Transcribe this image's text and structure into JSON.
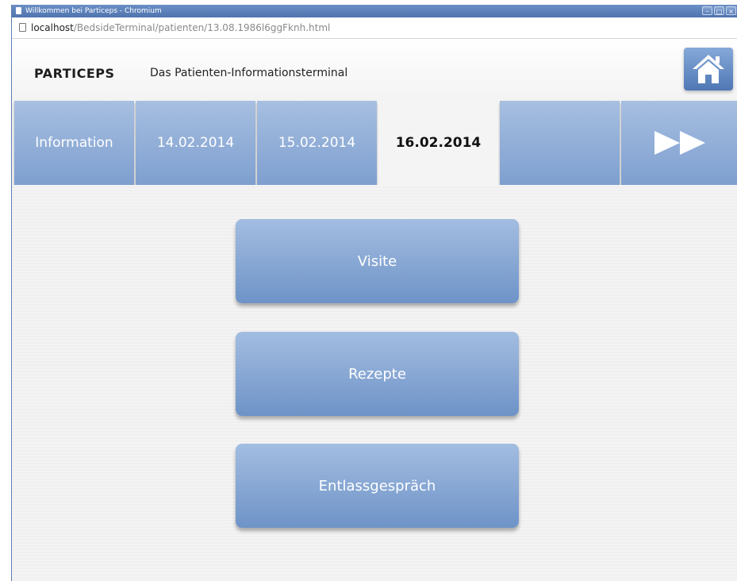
{
  "window": {
    "title": "Willkommen bei Particeps - Chromium",
    "controls": {
      "minimize": "–",
      "maximize": "□",
      "close": "×"
    }
  },
  "addressbar": {
    "url_host": "localhost",
    "url_path": "/BedsideTerminal/patienten/13.08.1986l6ggFknh.html"
  },
  "header": {
    "brand": "PARTICEPS",
    "subtitle": "Das Patienten-Informationsterminal",
    "home_icon": "home-icon"
  },
  "tabs": [
    {
      "label": "Information",
      "active": false
    },
    {
      "label": "14.02.2014",
      "active": false
    },
    {
      "label": "15.02.2014",
      "active": false
    },
    {
      "label": "16.02.2014",
      "active": true
    },
    {
      "label": "",
      "active": false
    },
    {
      "label": "",
      "icon": "next-icon",
      "active": false
    }
  ],
  "menu": {
    "buttons": [
      {
        "label": "Visite"
      },
      {
        "label": "Rezepte"
      },
      {
        "label": "Entlassgespräch"
      }
    ]
  },
  "colors": {
    "accent": "#7e9fcf",
    "accent_dark": "#4f77b4",
    "titlebar": "#5b7fb8"
  }
}
